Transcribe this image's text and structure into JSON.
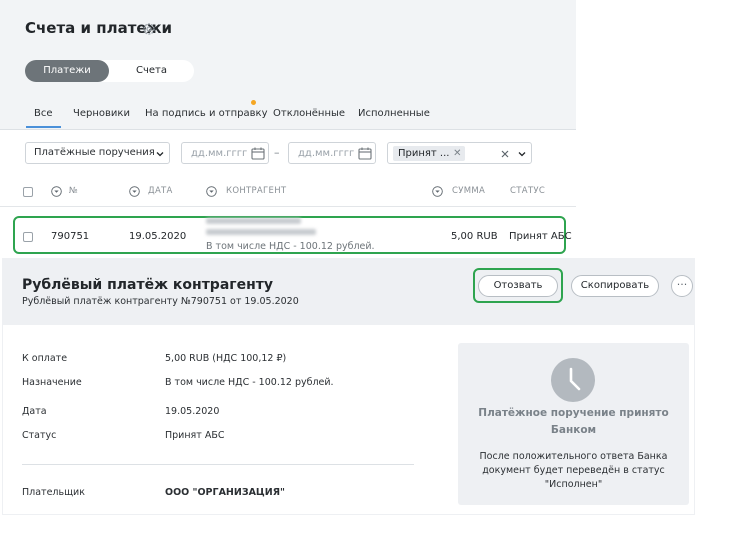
{
  "header": {
    "title": "Счета и платежи"
  },
  "segment": {
    "active": "Платежи",
    "inactive": "Счета"
  },
  "tabs": [
    {
      "label": "Все"
    },
    {
      "label": "Черновики"
    },
    {
      "label": "На подпись и отправку"
    },
    {
      "label": "Отклонённые"
    },
    {
      "label": "Исполненные"
    }
  ],
  "filters": {
    "doc_type": "Платёжные поручения",
    "date_from_placeholder": "дд.мм.гггг",
    "date_to_placeholder": "дд.мм.гггг",
    "date_separator": "–",
    "status_chip": "Принят ..."
  },
  "table": {
    "columns": {
      "number": "№",
      "date": "ДАТА",
      "counterparty": "КОНТРАГЕНТ",
      "amount": "СУММА",
      "status": "СТАТУС"
    },
    "rows": [
      {
        "number": "790751",
        "date": "19.05.2020",
        "purpose": "В том числе НДС - 100.12 рублей.",
        "amount": "5,00 RUB",
        "status": "Принят АБС"
      }
    ]
  },
  "detail": {
    "title": "Рублёвый платёж контрагенту",
    "subtitle": "Рублёвый платёж контрагенту №790751 от 19.05.2020",
    "buttons": {
      "revoke": "Отозвать",
      "copy": "Скопировать",
      "more": "···"
    },
    "fields": [
      {
        "label": "К оплате",
        "value": "5,00 RUB (НДС 100,12 ₽)"
      },
      {
        "label": "Назначение",
        "value": "В том числе НДС - 100.12 рублей."
      },
      {
        "label": "Дата",
        "value": "19.05.2020"
      },
      {
        "label": "Статус",
        "value": "Принят АБС"
      },
      {
        "label": "Плательщик",
        "value": "ООО \"ОРГАНИЗАЦИЯ\""
      }
    ],
    "info": {
      "title": "Платёжное поручение принято Банком",
      "text": "После положительного ответа Банка документ будет переведён в статус \"Исполнен\""
    }
  },
  "colors": {
    "accent_green": "#2ea44f",
    "active_segment": "#6d7479",
    "tab_dot": "#f5a623",
    "tab_underline": "#4a90d9"
  }
}
